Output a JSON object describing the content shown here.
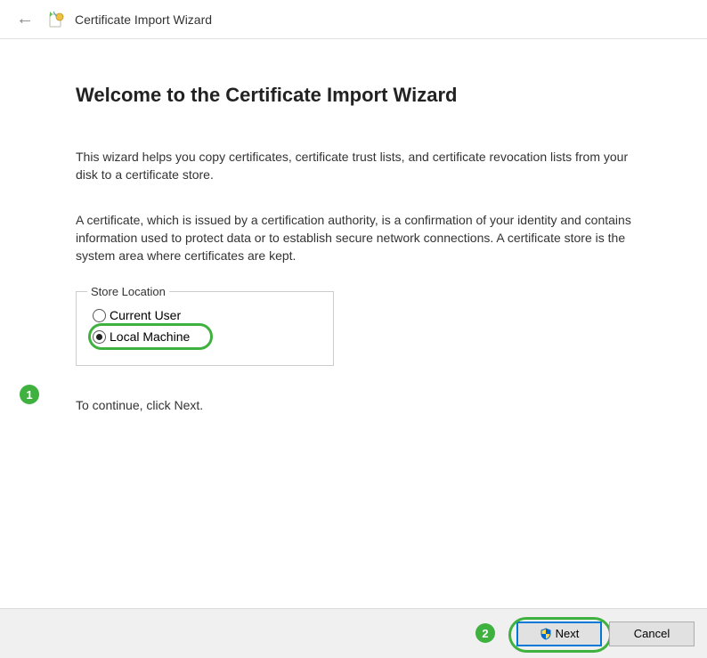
{
  "titlebar": {
    "title": "Certificate Import Wizard"
  },
  "content": {
    "heading": "Welcome to the Certificate Import Wizard",
    "para1": "This wizard helps you copy certificates, certificate trust lists, and certificate revocation lists from your disk to a certificate store.",
    "para2": "A certificate, which is issued by a certification authority, is a confirmation of your identity and contains information used to protect data or to establish secure network connections. A certificate store is the system area where certificates are kept.",
    "fieldset_label": "Store Location",
    "radio_current_user": "Current User",
    "radio_local_machine": "Local Machine",
    "continue_text": "To continue, click Next."
  },
  "footer": {
    "next_label": "Next",
    "cancel_label": "Cancel"
  },
  "annotations": {
    "badge1": "1",
    "badge2": "2"
  }
}
